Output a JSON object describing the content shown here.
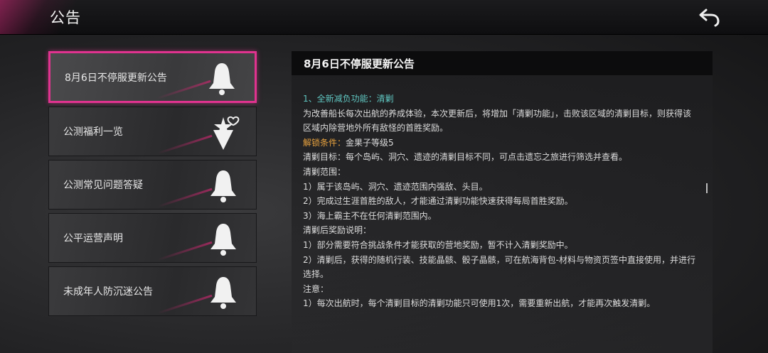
{
  "header": {
    "title": "公告",
    "back_icon": "back-arrow-icon"
  },
  "sidebar": {
    "items": [
      {
        "label": "8月6日不停服更新公告",
        "icon": "bell-icon",
        "active": true
      },
      {
        "label": "公测福利一览",
        "icon": "gift-bouquet-icon",
        "active": false
      },
      {
        "label": "公测常见问题答疑",
        "icon": "bell-icon",
        "active": false
      },
      {
        "label": "公平运营声明",
        "icon": "bell-icon",
        "active": false
      },
      {
        "label": "未成年人防沉迷公告",
        "icon": "bell-icon",
        "active": false
      }
    ]
  },
  "content": {
    "title": "8月6日不停服更新公告",
    "lines": [
      "1、全新减负功能：清剿",
      "为改善船长每次出航的养成体验，本次更新后，将增加「清剿功能」，击败该区域的清剿目标，则获得该区域内除营地外所有敌怪的首胜奖励。",
      "解锁条件：",
      "金果子等级5",
      "清剿目标：每个岛屿、洞穴、遗迹的清剿目标不同，可点击遗忘之旅进行筛选并查看。",
      "清剿范围：",
      "1）属于该岛屿、洞穴、遗迹范围内强敌、头目。",
      "2）完成过生涯首胜的敌人，才能通过清剿功能快速获得每局首胜奖励。",
      "3）海上霸主不在任何清剿范围内。",
      "清剿后奖励说明：",
      "1）部分需要符合挑战条件才能获取的营地奖励，暂不计入清剿奖励中。",
      "2）清剿后，获得的随机行装、技能晶骸、骰子晶骸，可在航海背包-材料与物资页签中直接使用，并进行选择。",
      "注意：",
      "1）每次出航时，每个清剿目标的清剿功能只可使用1次，需要重新出航，才能再次触发清剿。"
    ]
  },
  "colors": {
    "accent": "#e0338f",
    "teal": "#5fc5c0",
    "orange": "#e8a23e"
  }
}
